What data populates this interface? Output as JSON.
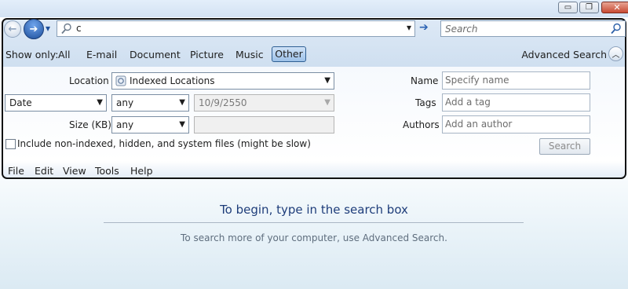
{
  "window": {
    "minimize_glyph": "▭",
    "maximize_glyph": "❐",
    "close_glyph": "✕"
  },
  "navigation": {
    "back_glyph": "←",
    "forward_glyph": "➔",
    "recent_glyph": "▾"
  },
  "search_bar": {
    "value": "c",
    "dropdown_glyph": "▾",
    "go_glyph": "➔",
    "right_placeholder": "Search"
  },
  "filter_bar": {
    "label": "Show only:",
    "filters": [
      "All",
      "E-mail",
      "Document",
      "Picture",
      "Music",
      "Other"
    ],
    "selected": "Other",
    "advanced_label": "Advanced Search",
    "advanced_toggle_glyph": "︿"
  },
  "advanced": {
    "location_label": "Location",
    "location_value": "Indexed Locations",
    "date_field": "Date",
    "date_operator": "any",
    "date_value": "10/9/2550",
    "size_label": "Size (KB)",
    "size_operator": "any",
    "size_value": "",
    "name_label": "Name",
    "name_placeholder": "Specify name",
    "tags_label": "Tags",
    "tags_placeholder": "Add a tag",
    "authors_label": "Authors",
    "authors_placeholder": "Add an author",
    "include_label": "Include non-indexed, hidden, and system files (might be slow)",
    "search_button": "Search"
  },
  "menubar": [
    "File",
    "Edit",
    "View",
    "Tools",
    "Help"
  ],
  "results": {
    "title": "To begin, type in the search box",
    "hint": "To search more of your computer, use Advanced Search."
  },
  "colors": {
    "accent": "#1e3d7a",
    "selected_filter_border": "#2f5f93"
  }
}
